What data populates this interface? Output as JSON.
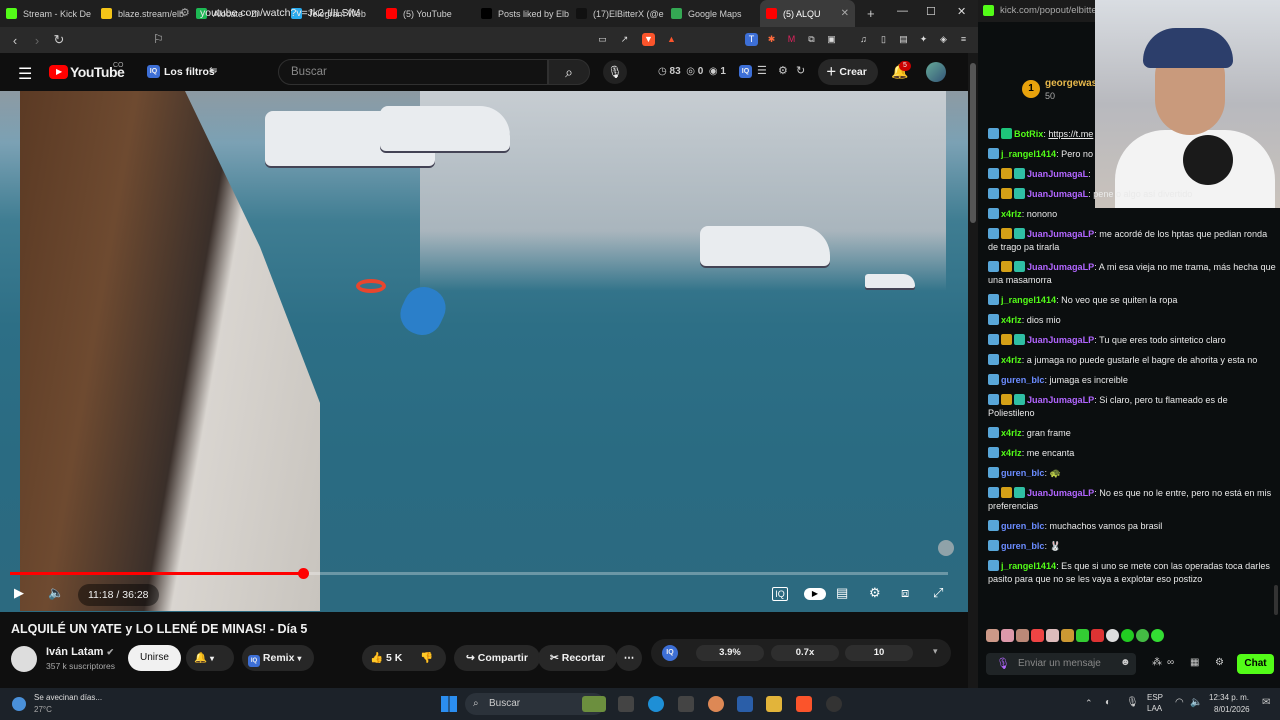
{
  "browser": {
    "tabs": [
      {
        "label": "Stream - Kick De",
        "color": "#53fc18"
      },
      {
        "label": "blaze.stream/elb",
        "color": "#f5c518"
      },
      {
        "label": "Alócate - Zi",
        "color": "#1db954"
      },
      {
        "label": "Telegram Web",
        "color": "#2aabee"
      },
      {
        "label": "(5) YouTube",
        "color": "#ff0000"
      },
      {
        "label": "Posts liked by Elb",
        "color": "#000000"
      },
      {
        "label": "(17)ElBitterX (@e",
        "color": "#111111"
      },
      {
        "label": "Google Maps",
        "color": "#34a853"
      },
      {
        "label": "(5) ALQU",
        "color": "#ff0000"
      }
    ],
    "new_tab": "+",
    "url": "youtube.com/watch?v=Jk2-tlILSfM",
    "window_controls": {
      "minimize": "—",
      "maximize": "☐",
      "close": "✕"
    }
  },
  "youtube": {
    "logo": "YouTube",
    "logo_sup": "CO",
    "filters_label": "Los filtros",
    "search_placeholder": "Buscar",
    "stats": {
      "a": "83",
      "b": "0",
      "c": "1"
    },
    "create_label": "Crear",
    "notif_count": "5",
    "video": {
      "current_time": "11:18",
      "duration": "36:28",
      "time_display": "11:18 / 36:28",
      "progress_fraction": 0.312
    },
    "title": "ALQUILÉ UN YATE y LO LLENÉ DE MINAS! - Día 5",
    "channel": "Iván Latam",
    "subscribers": "357 k suscriptores",
    "join_label": "Unirse",
    "remix_label": "Remix",
    "likes": "5 K",
    "share_label": "Compartir",
    "clip_label": "Recortar",
    "iq_stats": [
      "3.9%",
      "0.7x",
      "10"
    ]
  },
  "kick": {
    "url": "kick.com/popout/elbitterx/c",
    "top_user": "georgewas",
    "top_user_sub": "50",
    "chat": [
      {
        "user": "BotRix",
        "color": "#53fc18",
        "text": "https://t.me"
      },
      {
        "user": "j_rangel1414",
        "color": "#53fc18",
        "text": "Pero no"
      },
      {
        "user": "JuanJumagaL",
        "color": "#b266ff",
        "text": ""
      },
      {
        "user": "JuanJumagaL",
        "color": "#b266ff",
        "text": "pene o algo así divertido"
      },
      {
        "user": "x4rlz",
        "color": "#53fc18",
        "text": "nonono"
      },
      {
        "user": "JuanJumagaLP",
        "color": "#b266ff",
        "text": "me acordé de los hptas que pedian ronda de trago pa tirarla"
      },
      {
        "user": "JuanJumagaLP",
        "color": "#b266ff",
        "text": "A mi esa vieja no me trama, más hecha que una masamorra"
      },
      {
        "user": "j_rangel1414",
        "color": "#53fc18",
        "text": "No veo que se quiten la ropa"
      },
      {
        "user": "x4rlz",
        "color": "#53fc18",
        "text": "dios mio"
      },
      {
        "user": "JuanJumagaLP",
        "color": "#b266ff",
        "text": "Tu que eres todo sintetico claro"
      },
      {
        "user": "x4rlz",
        "color": "#53fc18",
        "text": "a jumaga no puede gustarle el bagre de ahorita y esta no"
      },
      {
        "user": "guren_blc",
        "color": "#6b8cff",
        "text": "jumaga es increible"
      },
      {
        "user": "JuanJumagaLP",
        "color": "#b266ff",
        "text": "Si claro, pero tu flameado es de Poliestileno"
      },
      {
        "user": "x4rlz",
        "color": "#53fc18",
        "text": "gran frame"
      },
      {
        "user": "x4rlz",
        "color": "#53fc18",
        "text": "me encanta"
      },
      {
        "user": "guren_blc",
        "color": "#6b8cff",
        "text": "🐢"
      },
      {
        "user": "JuanJumagaLP",
        "color": "#b266ff",
        "text": "No es que no le entre, pero no está en mis preferencias"
      },
      {
        "user": "guren_blc",
        "color": "#6b8cff",
        "text": "muchachos vamos pa brasil"
      },
      {
        "user": "guren_blc",
        "color": "#6b8cff",
        "text": "🐰"
      },
      {
        "user": "j_rangel1414",
        "color": "#53fc18",
        "text": "Es que si uno se mete con las operadas toca darles pasito para que no se les vaya a explotar eso postizo"
      }
    ],
    "input_placeholder": "Enviar un mensaje",
    "chat_button": "Chat"
  },
  "taskbar": {
    "weather_title": "Se avecinan días...",
    "weather_temp": "27°C",
    "search_placeholder": "Buscar",
    "lang": "ESP",
    "lang2": "LAA",
    "time": "12:34 p. m.",
    "date": "8/01/2026"
  }
}
